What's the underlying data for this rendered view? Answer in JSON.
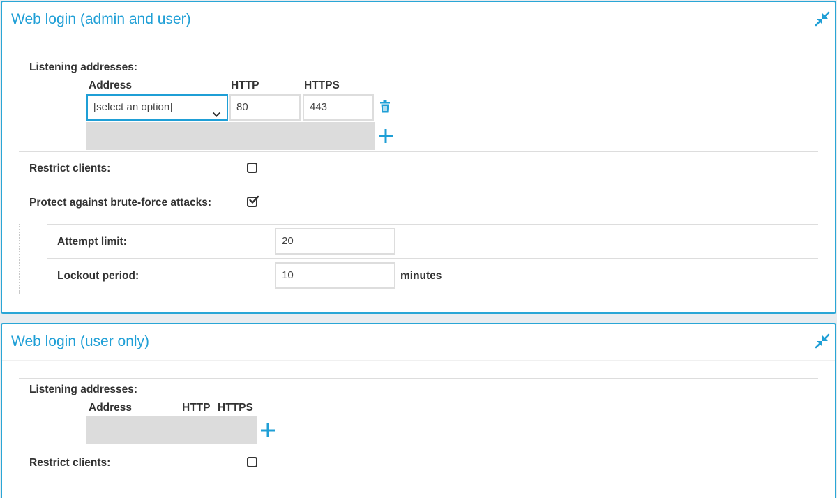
{
  "panels": {
    "admin_user": {
      "title": "Web login (admin and user)",
      "listening_label": "Listening addresses:",
      "columns": {
        "address": "Address",
        "http": "HTTP",
        "https": "HTTPS"
      },
      "row": {
        "address": "[select an option]",
        "http": "80",
        "https": "443"
      },
      "restrict_label": "Restrict clients:",
      "restrict_checked": false,
      "bruteforce_label": "Protect against brute-force attacks:",
      "bruteforce_checked": true,
      "attempt_label": "Attempt limit:",
      "attempt_value": "20",
      "lockout_label": "Lockout period:",
      "lockout_value": "10",
      "lockout_unit": "minutes"
    },
    "user_only": {
      "title": "Web login (user only)",
      "listening_label": "Listening addresses:",
      "columns": {
        "address": "Address",
        "http": "HTTP",
        "https": "HTTPS"
      },
      "restrict_label": "Restrict clients:",
      "restrict_checked": false
    }
  },
  "icons": {
    "collapse": "collapse-arrows-icon",
    "delete": "trash-icon",
    "add": "plus-icon",
    "dropdown": "chevron-down-icon",
    "checked": "checkmark-icon"
  },
  "colors": {
    "accent": "#1f9fd6",
    "border": "#2aa6d6",
    "grey_bar": "#dcdcdc"
  }
}
